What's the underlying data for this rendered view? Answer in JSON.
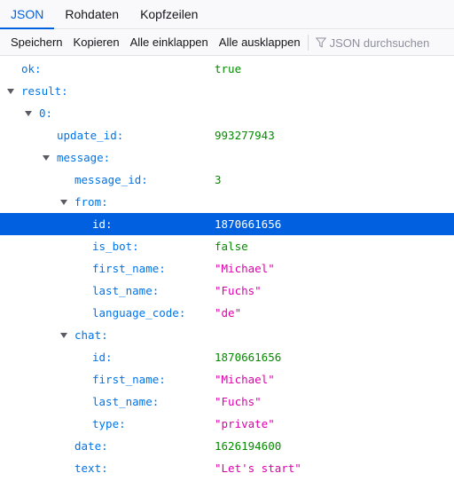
{
  "tabs": [
    "JSON",
    "Rohdaten",
    "Kopfzeilen"
  ],
  "toolbar": {
    "save": "Speichern",
    "copy": "Kopieren",
    "collapse_all": "Alle einklappen",
    "expand_all": "Alle ausklappen",
    "filter_placeholder": "JSON durchsuchen"
  },
  "rows": [
    {
      "key": "ok:",
      "value": "true",
      "type": "bool"
    },
    {
      "key": "result:",
      "value": ""
    },
    {
      "key": "0:",
      "value": ""
    },
    {
      "key": "update_id:",
      "value": "993277943",
      "type": "num"
    },
    {
      "key": "message:",
      "value": ""
    },
    {
      "key": "message_id:",
      "value": "3",
      "type": "num"
    },
    {
      "key": "from:",
      "value": ""
    },
    {
      "key": "id:",
      "value": "1870661656",
      "type": "num"
    },
    {
      "key": "is_bot:",
      "value": "false",
      "type": "bool"
    },
    {
      "key": "first_name:",
      "value": "\"Michael\"",
      "type": "str"
    },
    {
      "key": "last_name:",
      "value": "\"Fuchs\"",
      "type": "str"
    },
    {
      "key": "language_code:",
      "value": "\"de\"",
      "type": "str"
    },
    {
      "key": "chat:",
      "value": ""
    },
    {
      "key": "id:",
      "value": "1870661656",
      "type": "num"
    },
    {
      "key": "first_name:",
      "value": "\"Michael\"",
      "type": "str"
    },
    {
      "key": "last_name:",
      "value": "\"Fuchs\"",
      "type": "str"
    },
    {
      "key": "type:",
      "value": "\"private\"",
      "type": "str"
    },
    {
      "key": "date:",
      "value": "1626194600",
      "type": "num"
    },
    {
      "key": "text:",
      "value": "\"Let's start\"",
      "type": "str"
    }
  ],
  "colors": {
    "accent": "#0061e0",
    "key": "#0074e8",
    "number_bool": "#058b00",
    "string": "#dd00a9",
    "selection": "#0060df"
  },
  "icons": {
    "filter": "funnel-icon",
    "expand": "triangle-down-icon"
  }
}
